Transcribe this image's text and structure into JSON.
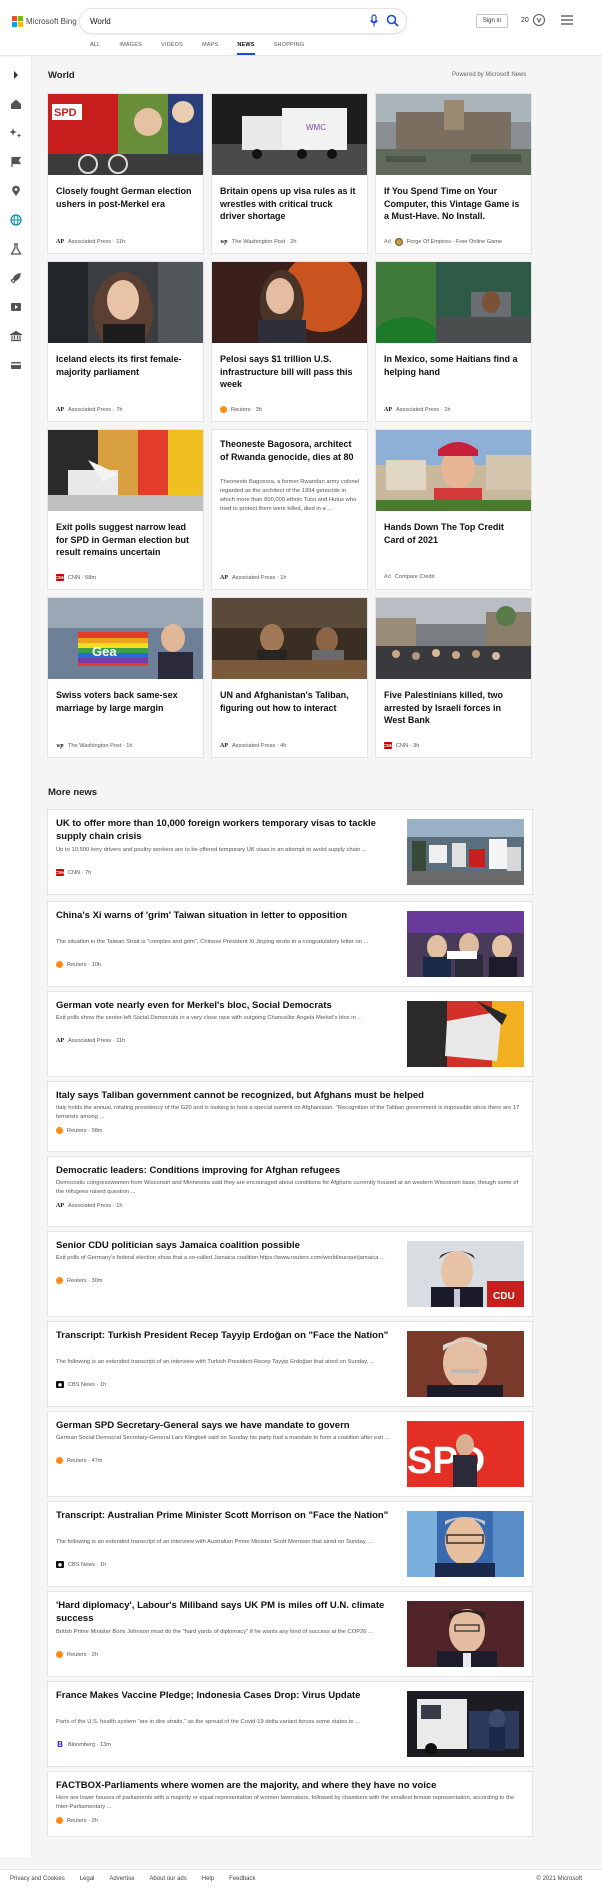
{
  "brand": {
    "name": "Microsoft Bing",
    "colors": [
      "#f25022",
      "#7fba00",
      "#00a4ef",
      "#ffb900"
    ]
  },
  "search": {
    "query": "World"
  },
  "header": {
    "signin_label": "Sign in",
    "rewards_count": "20"
  },
  "scope_tabs": [
    "ALL",
    "IMAGES",
    "VIDEOS",
    "MAPS",
    "NEWS",
    "SHOPPING"
  ],
  "active_tab": "NEWS",
  "accent_color": "#174ae4",
  "rail_icons": [
    "chevron-right-icon",
    "home-icon",
    "sparkle-icon",
    "flag-icon",
    "location-pin-icon",
    "globe-icon",
    "science-icon",
    "rocket-icon",
    "movie-icon",
    "bank-icon",
    "card-icon"
  ],
  "section": {
    "title": "World",
    "powered_by": "Powered by Microsoft News"
  },
  "cards": [
    {
      "title": "Closely fought German election ushers in post-Merkel era",
      "source": "Associated Press",
      "time": "11h",
      "logo": "AP"
    },
    {
      "title": "Britain opens up visa rules as it wrestles with critical truck driver shortage",
      "source": "The Washington Post",
      "time": "2h",
      "logo": "WP"
    },
    {
      "title": "If You Spend Time on Your Computer, this Vintage Game is a Must-Have. No Install.",
      "ad_label": "Ad",
      "source": "Forge Of Empires - Free Online Game",
      "time": "",
      "logo": "FORGE"
    },
    {
      "title": "Iceland elects its first female-majority parliament",
      "source": "Associated Press",
      "time": "7h",
      "logo": "AP"
    },
    {
      "title": "Pelosi says $1 trillion U.S. infrastructure bill will pass this week",
      "source": "Reuters",
      "time": "3h",
      "logo": "REUTERS"
    },
    {
      "title": "In Mexico, some Haitians find a helping hand",
      "source": "Associated Press",
      "time": "1h",
      "logo": "AP"
    },
    {
      "title": "Exit polls suggest narrow lead for SPD in German election but result remains uncertain",
      "source": "CNN",
      "time": "58m",
      "logo": "CNN"
    },
    {
      "title": "Theoneste Bagosora, architect of Rwanda genocide, dies at 80",
      "snippet": "Theoneste Bagosora, a former Rwandan army colonel regarded as the architect of the 1994 genocide in which more than 800,000 ethnic Tutsi and Hutus who tried to protect them were killed, died in a ...",
      "source": "Associated Press",
      "time": "1h",
      "logo": "AP"
    },
    {
      "title": "Hands Down The Top Credit Card of 2021",
      "ad_label": "Ad",
      "source": "Compare Credit",
      "time": "",
      "logo": ""
    },
    {
      "title": "Swiss voters back same-sex marriage by large margin",
      "source": "The Washington Post",
      "time": "1h",
      "logo": "WP"
    },
    {
      "title": "UN and Afghanistan's Taliban, figuring out how to interact",
      "source": "Associated Press",
      "time": "4h",
      "logo": "AP"
    },
    {
      "title": "Five Palestinians killed, two arrested by Israeli forces in West Bank",
      "source": "CNN",
      "time": "3h",
      "logo": "CNN"
    }
  ],
  "more_news": {
    "title": "More news",
    "items": [
      {
        "title": "UK to offer more than 10,000 foreign workers temporary visas to tackle supply chain crisis",
        "snippet": "Up to 10,500 lorry drivers and poultry workers are to be offered temporary UK visas in an attempt to avoid supply chain ...",
        "source": "CNN",
        "time": "7h",
        "logo": "CNN"
      },
      {
        "title": "China's Xi warns of 'grim' Taiwan situation in letter to opposition",
        "snippet": "The situation in the Taiwan Strait is \"complex and grim\", Chinese President Xi Jinping wrote in a congratulatory letter on ...",
        "source": "Reuters",
        "time": "10h",
        "logo": "REUTERS"
      },
      {
        "title": "German vote nearly even for Merkel's bloc, Social Democrats",
        "snippet": "Exit polls show the center-left Social Democrats in a very close race with outgoing Chancellor Angela Merkel's bloc in ...",
        "source": "Associated Press",
        "time": "11h",
        "logo": "AP"
      },
      {
        "title": "Italy says Taliban government cannot be recognized, but Afghans must be helped",
        "snippet": "Italy holds the annual, rotating presidency of the G20 and is looking to host a special summit on Afghanistan. \"Recognition of the Taliban government is impossible since there are 17 terrorists among ...",
        "source": "Reuters",
        "time": "58m",
        "logo": "REUTERS"
      },
      {
        "title": "Democratic leaders: Conditions improving for Afghan refugees",
        "snippet": "Democratic congresswomen from Wisconsin and Minnesota said they are encouraged about conditions for Afghans currently housed at an western Wisconsin base, though some of the refugees raised question ...",
        "source": "Associated Press",
        "time": "1h",
        "logo": "AP"
      },
      {
        "title": "Senior CDU politician says Jamaica coalition possible",
        "snippet": "Exit polls of Germany's federal election show that a so-called Jamaica coalition https://www.reuters.com/world/europe/jamaica ...",
        "source": "Reuters",
        "time": "30m",
        "logo": "REUTERS"
      },
      {
        "title": "Transcript: Turkish President Recep Tayyip Erdoğan on \"Face the Nation\"",
        "snippet": "The following is an extended transcript of an interview with Turkish President Recep Tayyip Erdoğan that aired on Sunday, ...",
        "source": "CBS News",
        "time": "1h",
        "logo": "CBS"
      },
      {
        "title": "German SPD Secretary-General says we have mandate to govern",
        "snippet": "German Social Democrat Secretary-General Lars Klingbeil said on Sunday his party had a mandate to form a coalition after exit ...",
        "source": "Reuters",
        "time": "47m",
        "logo": "REUTERS"
      },
      {
        "title": "Transcript: Australian Prime Minister Scott Morrison on \"Face the Nation\"",
        "snippet": "The following is an extended transcript of an interview with Australian Prime Minister Scott Morrison that aired on Sunday, ...",
        "source": "CBS News",
        "time": "1h",
        "logo": "CBS"
      },
      {
        "title": "'Hard diplomacy', Labour's Miliband says UK PM is miles off U.N. climate success",
        "snippet": "British Prime Minister Boris Johnson must do the \"hard yards of diplomacy\" if he wants any kind of success at the COP26 ...",
        "source": "Reuters",
        "time": "2h",
        "logo": "REUTERS"
      },
      {
        "title": "France Makes Vaccine Pledge; Indonesia Cases Drop: Virus Update",
        "snippet": "Parts of the U.S. health system \"are in dire straits,\" as the spread of the Covid-19 delta variant forces some states to ...",
        "source": "Bloomberg",
        "time": "13m",
        "logo": "B"
      },
      {
        "title": "FACTBOX-Parliaments where women are the majority, and where they have no voice",
        "snippet": "Here are lower houses of parliaments with a majority or equal representation of women lawmakers, followed by chambers with the smallest female representation, according to the Inter-Parliamentary ...",
        "source": "Reuters",
        "time": "2h",
        "logo": "REUTERS"
      }
    ]
  },
  "footer": {
    "links": [
      "Privacy and Cookies",
      "Legal",
      "Advertise",
      "About our ads",
      "Help",
      "Feedback"
    ],
    "copyright": "© 2021 Microsoft"
  }
}
